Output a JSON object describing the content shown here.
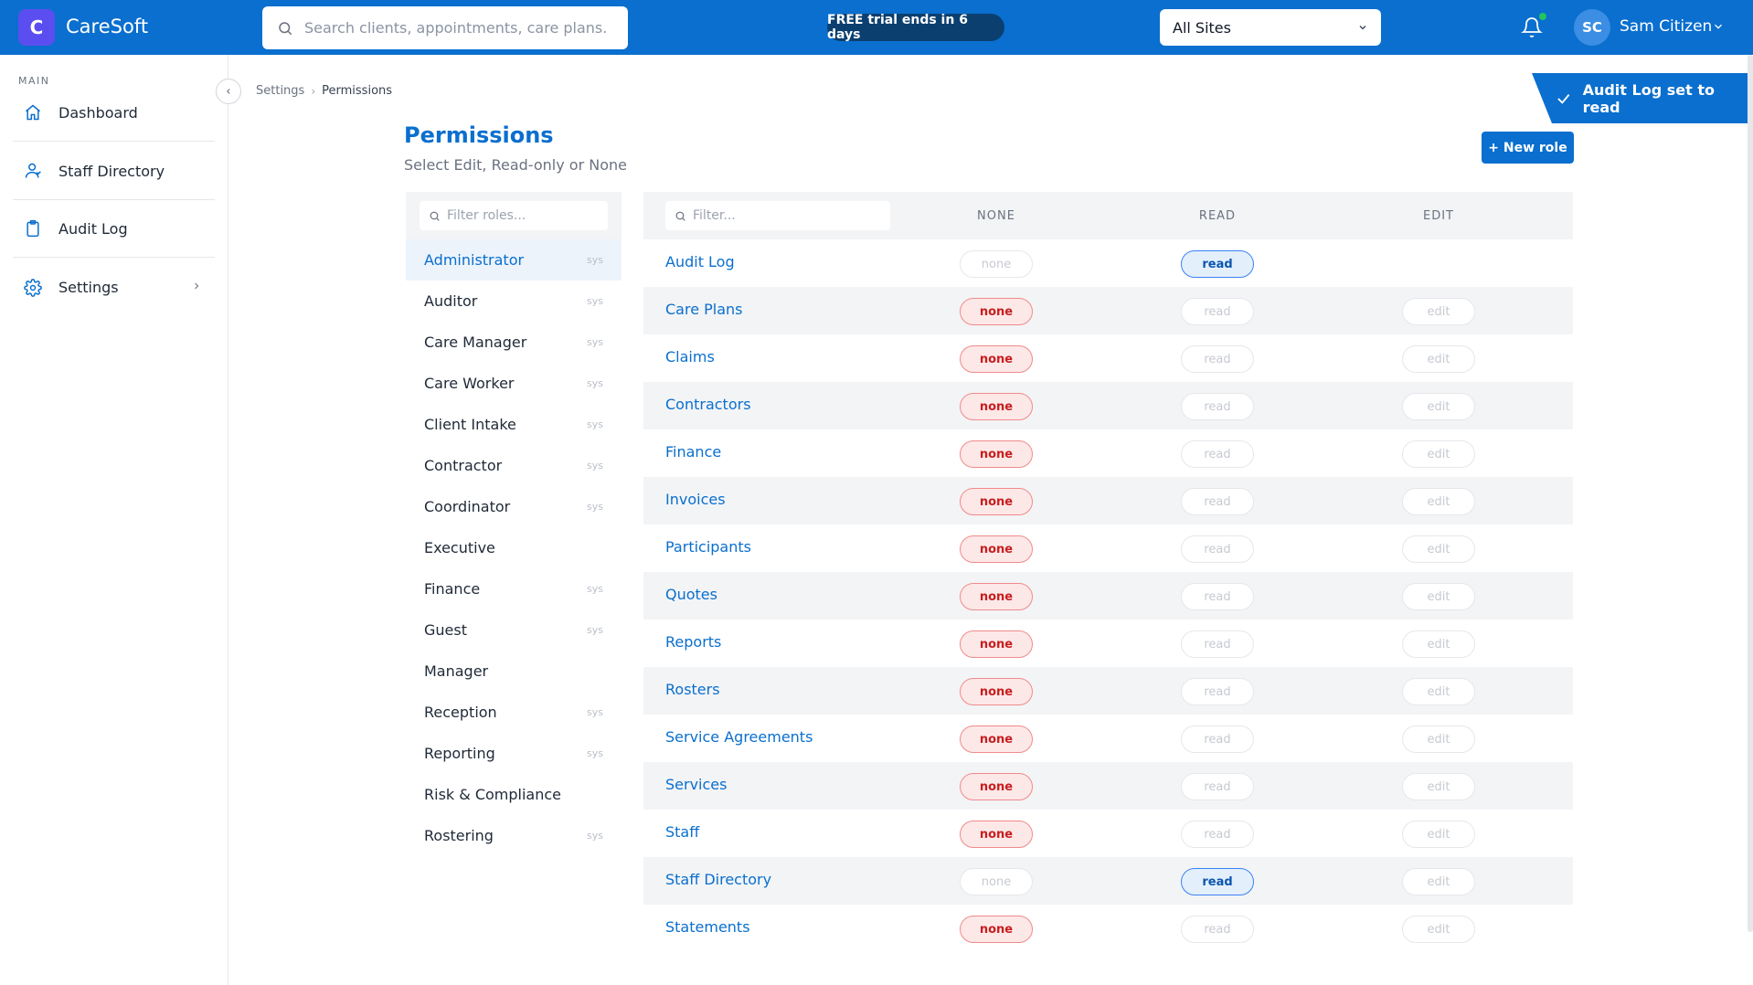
{
  "app": {
    "logo_letter": "C",
    "name": "CareSoft"
  },
  "topbar": {
    "search_placeholder": "Search clients, appointments, care plans.",
    "trial_badge": "FREE trial ends in 6 days",
    "site_selector": "All Sites",
    "user_initials": "SC",
    "user_name": "Sam Citizen"
  },
  "sidebar": {
    "section": "MAIN",
    "items": [
      {
        "label": "Dashboard",
        "icon": "home-icon"
      },
      {
        "label": "Staff Directory",
        "icon": "user-icon"
      },
      {
        "label": "Audit Log",
        "icon": "clipboard-icon"
      },
      {
        "label": "Settings",
        "icon": "gear-icon"
      }
    ]
  },
  "breadcrumb": {
    "parent": "Settings",
    "current": "Permissions"
  },
  "toast": {
    "message": "Audit Log set to read"
  },
  "page": {
    "title": "Permissions",
    "subtitle": "Select Edit, Read-only or None",
    "new_role_button": "+ New role"
  },
  "roles": {
    "filter_placeholder": "Filter roles...",
    "items": [
      {
        "name": "Administrator",
        "tag": "sys",
        "active": true
      },
      {
        "name": "Auditor",
        "tag": "sys"
      },
      {
        "name": "Care Manager",
        "tag": "sys"
      },
      {
        "name": "Care Worker",
        "tag": "sys"
      },
      {
        "name": "Client Intake",
        "tag": "sys"
      },
      {
        "name": "Contractor",
        "tag": "sys"
      },
      {
        "name": "Coordinator",
        "tag": "sys"
      },
      {
        "name": "Executive",
        "tag": ""
      },
      {
        "name": "Finance",
        "tag": "sys"
      },
      {
        "name": "Guest",
        "tag": "sys"
      },
      {
        "name": "Manager",
        "tag": ""
      },
      {
        "name": "Reception",
        "tag": "sys"
      },
      {
        "name": "Reporting",
        "tag": "sys"
      },
      {
        "name": "Risk & Compliance",
        "tag": ""
      },
      {
        "name": "Rostering",
        "tag": "sys"
      }
    ]
  },
  "permissions": {
    "filter_placeholder": "Filter...",
    "columns": [
      "NONE",
      "READ",
      "EDIT"
    ],
    "pill_labels": {
      "none": "none",
      "read": "read",
      "edit": "edit"
    },
    "rows": [
      {
        "module": "Audit Log",
        "value": "read",
        "edit_available": false
      },
      {
        "module": "Care Plans",
        "value": "none",
        "edit_available": true
      },
      {
        "module": "Claims",
        "value": "none",
        "edit_available": true
      },
      {
        "module": "Contractors",
        "value": "none",
        "edit_available": true
      },
      {
        "module": "Finance",
        "value": "none",
        "edit_available": true
      },
      {
        "module": "Invoices",
        "value": "none",
        "edit_available": true
      },
      {
        "module": "Participants",
        "value": "none",
        "edit_available": true
      },
      {
        "module": "Quotes",
        "value": "none",
        "edit_available": true
      },
      {
        "module": "Reports",
        "value": "none",
        "edit_available": true
      },
      {
        "module": "Rosters",
        "value": "none",
        "edit_available": true
      },
      {
        "module": "Service Agreements",
        "value": "none",
        "edit_available": true
      },
      {
        "module": "Services",
        "value": "none",
        "edit_available": true
      },
      {
        "module": "Staff",
        "value": "none",
        "edit_available": true
      },
      {
        "module": "Staff Directory",
        "value": "read",
        "edit_available": true
      },
      {
        "module": "Statements",
        "value": "none",
        "edit_available": true
      }
    ]
  },
  "colors": {
    "primary": "#0a6fce",
    "logo": "#5b4ef0",
    "trial_badge": "#0b3f70",
    "none_active": "#c81e1e",
    "read_active": "#0a56b0"
  }
}
